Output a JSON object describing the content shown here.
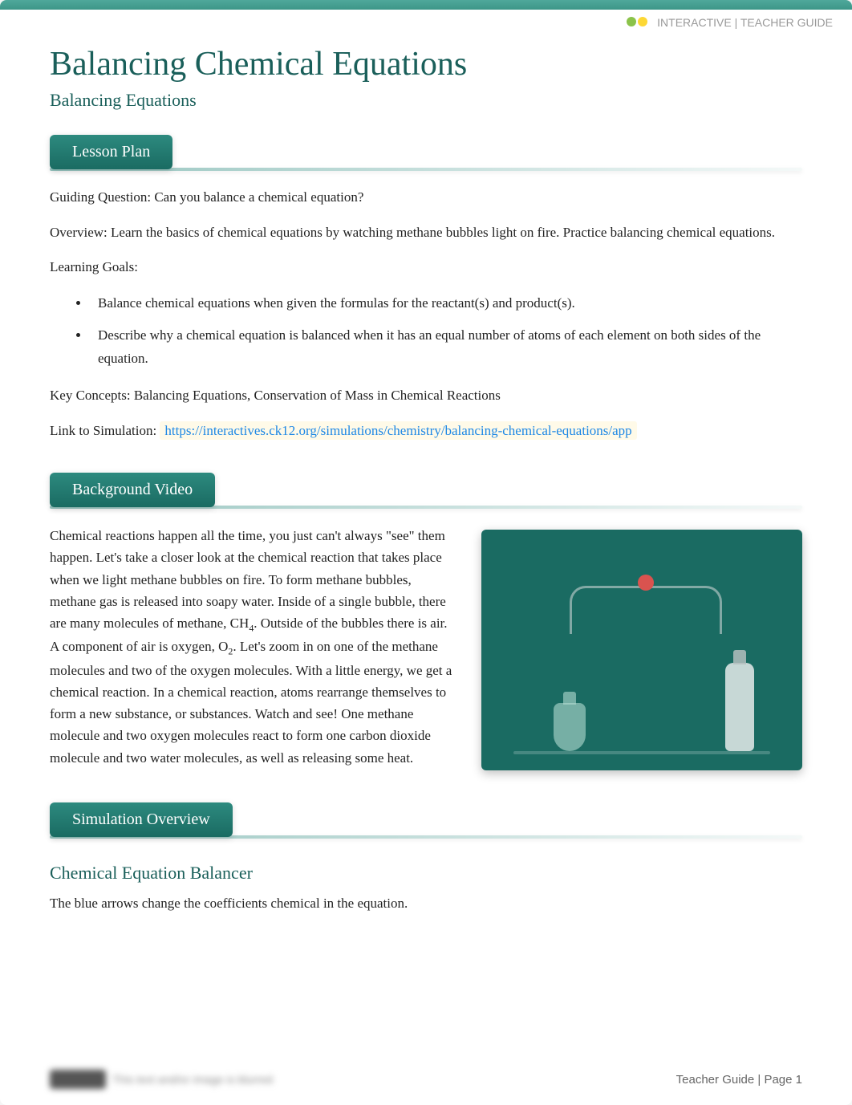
{
  "brand": {
    "text": "INTERACTIVE | TEACHER GUIDE"
  },
  "title": "Balancing Chemical Equations",
  "subtitle": "Balancing Equations",
  "sections": {
    "lesson_plan": {
      "heading": "Lesson Plan",
      "guiding_label": "Guiding Question:   ",
      "guiding_text": "Can you balance a chemical equation?",
      "overview_label": "Overview:  ",
      "overview_text": "Learn the basics of chemical equations by watching methane bubbles light on fire. Practice balancing chemical equations.",
      "goals_label": "Learning Goals:",
      "goals": [
        "Balance chemical equations when given the formulas for the reactant(s) and product(s).",
        "Describe why a chemical equation is balanced when it has an equal number of atoms of each element on both sides of the equation."
      ],
      "concepts_label": "Key Concepts:   ",
      "concepts_text": "Balancing Equations, Conservation of Mass in Chemical Reactions",
      "link_label": "Link to Simulation:   ",
      "link_url": "https://interactives.ck12.org/simulations/chemistry/balancing-chemical-equations/app"
    },
    "background_video": {
      "heading": "Background Video",
      "text_before_ch4": "Chemical reactions happen all the time, you just can't always \"see\" them happen. Let's take a closer look at the chemical reaction that takes place when we light methane bubbles on fire. To form methane bubbles, methane gas is released into soapy water. Inside of a single bubble, there are many molecules of methane, CH",
      "ch4_sub": "4",
      "text_after_ch4": ". Outside of the bubbles there is air. A component of air is oxygen, O",
      "o2_sub": "2",
      "text_after_o2": ". Let's zoom in on one of the methane molecules and two of the oxygen molecules. With a little energy, we get a chemical reaction. In a chemical reaction, atoms rearrange themselves to form a new substance, or substances.          Watch and see! One methane molecule and two oxygen molecules react to form one carbon dioxide molecule and two water molecules, as well as releasing some heat."
    },
    "simulation_overview": {
      "heading": "Simulation Overview",
      "subsection": "Chemical Equation Balancer",
      "text": "The blue arrows change the coefficients chemical in the equation."
    }
  },
  "footer": {
    "blur_text": "This text and/or image is blurred",
    "right": "Teacher Guide | Page 1"
  }
}
